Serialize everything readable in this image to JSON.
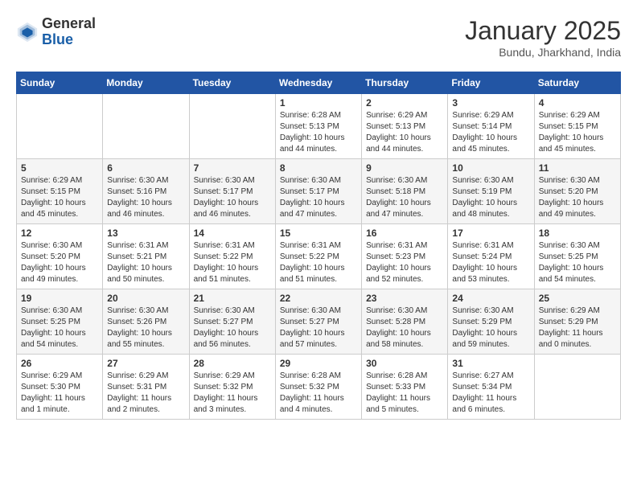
{
  "logo": {
    "general": "General",
    "blue": "Blue"
  },
  "title": "January 2025",
  "subtitle": "Bundu, Jharkhand, India",
  "days_header": [
    "Sunday",
    "Monday",
    "Tuesday",
    "Wednesday",
    "Thursday",
    "Friday",
    "Saturday"
  ],
  "weeks": [
    [
      {
        "day": "",
        "info": ""
      },
      {
        "day": "",
        "info": ""
      },
      {
        "day": "",
        "info": ""
      },
      {
        "day": "1",
        "info": "Sunrise: 6:28 AM\nSunset: 5:13 PM\nDaylight: 10 hours\nand 44 minutes."
      },
      {
        "day": "2",
        "info": "Sunrise: 6:29 AM\nSunset: 5:13 PM\nDaylight: 10 hours\nand 44 minutes."
      },
      {
        "day": "3",
        "info": "Sunrise: 6:29 AM\nSunset: 5:14 PM\nDaylight: 10 hours\nand 45 minutes."
      },
      {
        "day": "4",
        "info": "Sunrise: 6:29 AM\nSunset: 5:15 PM\nDaylight: 10 hours\nand 45 minutes."
      }
    ],
    [
      {
        "day": "5",
        "info": "Sunrise: 6:29 AM\nSunset: 5:15 PM\nDaylight: 10 hours\nand 45 minutes."
      },
      {
        "day": "6",
        "info": "Sunrise: 6:30 AM\nSunset: 5:16 PM\nDaylight: 10 hours\nand 46 minutes."
      },
      {
        "day": "7",
        "info": "Sunrise: 6:30 AM\nSunset: 5:17 PM\nDaylight: 10 hours\nand 46 minutes."
      },
      {
        "day": "8",
        "info": "Sunrise: 6:30 AM\nSunset: 5:17 PM\nDaylight: 10 hours\nand 47 minutes."
      },
      {
        "day": "9",
        "info": "Sunrise: 6:30 AM\nSunset: 5:18 PM\nDaylight: 10 hours\nand 47 minutes."
      },
      {
        "day": "10",
        "info": "Sunrise: 6:30 AM\nSunset: 5:19 PM\nDaylight: 10 hours\nand 48 minutes."
      },
      {
        "day": "11",
        "info": "Sunrise: 6:30 AM\nSunset: 5:20 PM\nDaylight: 10 hours\nand 49 minutes."
      }
    ],
    [
      {
        "day": "12",
        "info": "Sunrise: 6:30 AM\nSunset: 5:20 PM\nDaylight: 10 hours\nand 49 minutes."
      },
      {
        "day": "13",
        "info": "Sunrise: 6:31 AM\nSunset: 5:21 PM\nDaylight: 10 hours\nand 50 minutes."
      },
      {
        "day": "14",
        "info": "Sunrise: 6:31 AM\nSunset: 5:22 PM\nDaylight: 10 hours\nand 51 minutes."
      },
      {
        "day": "15",
        "info": "Sunrise: 6:31 AM\nSunset: 5:22 PM\nDaylight: 10 hours\nand 51 minutes."
      },
      {
        "day": "16",
        "info": "Sunrise: 6:31 AM\nSunset: 5:23 PM\nDaylight: 10 hours\nand 52 minutes."
      },
      {
        "day": "17",
        "info": "Sunrise: 6:31 AM\nSunset: 5:24 PM\nDaylight: 10 hours\nand 53 minutes."
      },
      {
        "day": "18",
        "info": "Sunrise: 6:30 AM\nSunset: 5:25 PM\nDaylight: 10 hours\nand 54 minutes."
      }
    ],
    [
      {
        "day": "19",
        "info": "Sunrise: 6:30 AM\nSunset: 5:25 PM\nDaylight: 10 hours\nand 54 minutes."
      },
      {
        "day": "20",
        "info": "Sunrise: 6:30 AM\nSunset: 5:26 PM\nDaylight: 10 hours\nand 55 minutes."
      },
      {
        "day": "21",
        "info": "Sunrise: 6:30 AM\nSunset: 5:27 PM\nDaylight: 10 hours\nand 56 minutes."
      },
      {
        "day": "22",
        "info": "Sunrise: 6:30 AM\nSunset: 5:27 PM\nDaylight: 10 hours\nand 57 minutes."
      },
      {
        "day": "23",
        "info": "Sunrise: 6:30 AM\nSunset: 5:28 PM\nDaylight: 10 hours\nand 58 minutes."
      },
      {
        "day": "24",
        "info": "Sunrise: 6:30 AM\nSunset: 5:29 PM\nDaylight: 10 hours\nand 59 minutes."
      },
      {
        "day": "25",
        "info": "Sunrise: 6:29 AM\nSunset: 5:29 PM\nDaylight: 11 hours\nand 0 minutes."
      }
    ],
    [
      {
        "day": "26",
        "info": "Sunrise: 6:29 AM\nSunset: 5:30 PM\nDaylight: 11 hours\nand 1 minute."
      },
      {
        "day": "27",
        "info": "Sunrise: 6:29 AM\nSunset: 5:31 PM\nDaylight: 11 hours\nand 2 minutes."
      },
      {
        "day": "28",
        "info": "Sunrise: 6:29 AM\nSunset: 5:32 PM\nDaylight: 11 hours\nand 3 minutes."
      },
      {
        "day": "29",
        "info": "Sunrise: 6:28 AM\nSunset: 5:32 PM\nDaylight: 11 hours\nand 4 minutes."
      },
      {
        "day": "30",
        "info": "Sunrise: 6:28 AM\nSunset: 5:33 PM\nDaylight: 11 hours\nand 5 minutes."
      },
      {
        "day": "31",
        "info": "Sunrise: 6:27 AM\nSunset: 5:34 PM\nDaylight: 11 hours\nand 6 minutes."
      },
      {
        "day": "",
        "info": ""
      }
    ]
  ]
}
